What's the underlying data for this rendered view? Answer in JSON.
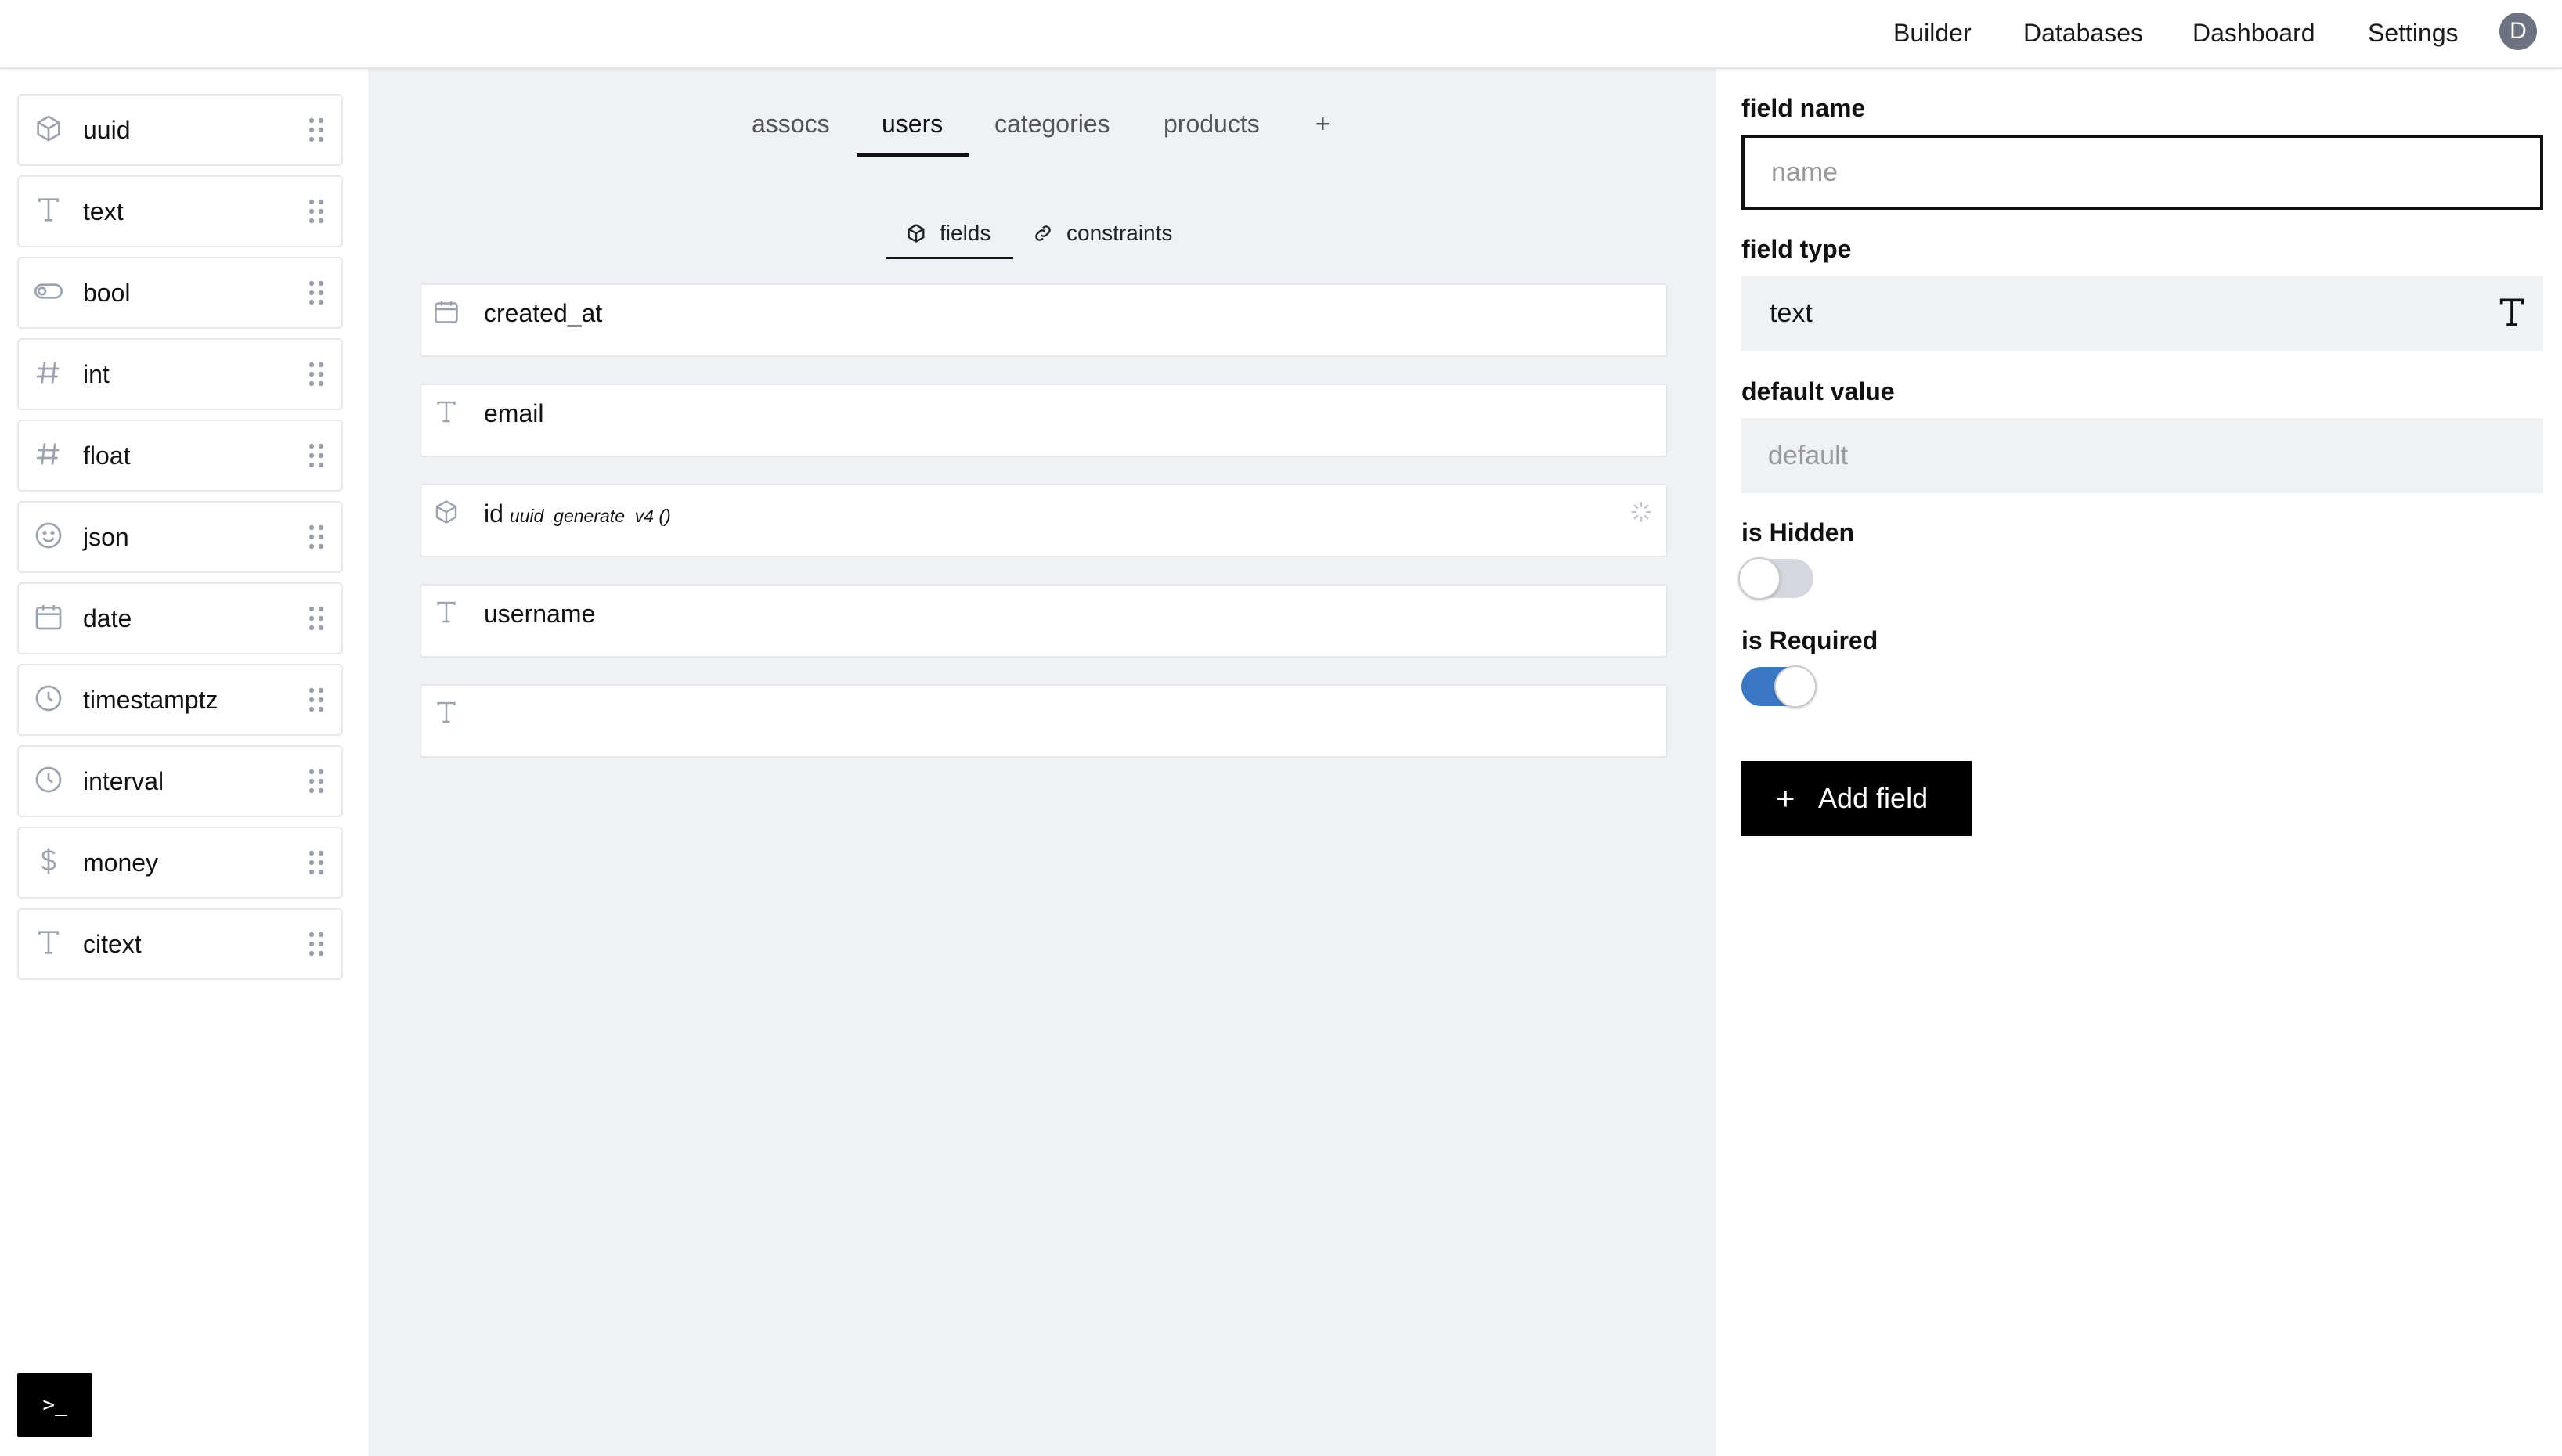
{
  "nav": {
    "links": [
      "Builder",
      "Databases",
      "Dashboard",
      "Settings"
    ],
    "avatar_initial": "D"
  },
  "sidebar": {
    "types": [
      {
        "label": "uuid",
        "icon": "cube-icon"
      },
      {
        "label": "text",
        "icon": "text-type-icon"
      },
      {
        "label": "bool",
        "icon": "toggle-icon"
      },
      {
        "label": "int",
        "icon": "hash-icon"
      },
      {
        "label": "float",
        "icon": "hash-icon"
      },
      {
        "label": "json",
        "icon": "smiley-icon"
      },
      {
        "label": "date",
        "icon": "calendar-icon"
      },
      {
        "label": "timestamptz",
        "icon": "clock-icon"
      },
      {
        "label": "interval",
        "icon": "clock-icon"
      },
      {
        "label": "money",
        "icon": "dollar-icon"
      },
      {
        "label": "citext",
        "icon": "text-type-icon"
      }
    ],
    "terminal_label": ">_"
  },
  "center": {
    "tables": [
      "assocs",
      "users",
      "categories",
      "products"
    ],
    "active_table": "users",
    "add_table_label": "+",
    "subtabs": [
      "fields",
      "constraints"
    ],
    "active_subtab": "fields",
    "fields": [
      {
        "name": "created_at",
        "default": "",
        "icon": "calendar-icon"
      },
      {
        "name": "email",
        "default": "",
        "icon": "text-type-icon"
      },
      {
        "name": "id",
        "default": "uuid_generate_v4 ()",
        "icon": "cube-icon"
      },
      {
        "name": "username",
        "default": "",
        "icon": "text-type-icon"
      },
      {
        "name": "",
        "default": "",
        "icon": "text-type-icon"
      }
    ]
  },
  "panel": {
    "field_name_label": "field name",
    "field_name_placeholder": "name",
    "field_name_value": "",
    "field_type_label": "field type",
    "field_type_value": "text",
    "default_value_label": "default value",
    "default_value_placeholder": "default",
    "is_hidden_label": "is Hidden",
    "is_hidden": false,
    "is_required_label": "is Required",
    "is_required": true,
    "add_button_plus": "+",
    "add_button_label": "Add field"
  },
  "colors": {
    "accent": "#3a78c4",
    "center_bg": "#eef1f6",
    "button_bg": "#000000"
  }
}
